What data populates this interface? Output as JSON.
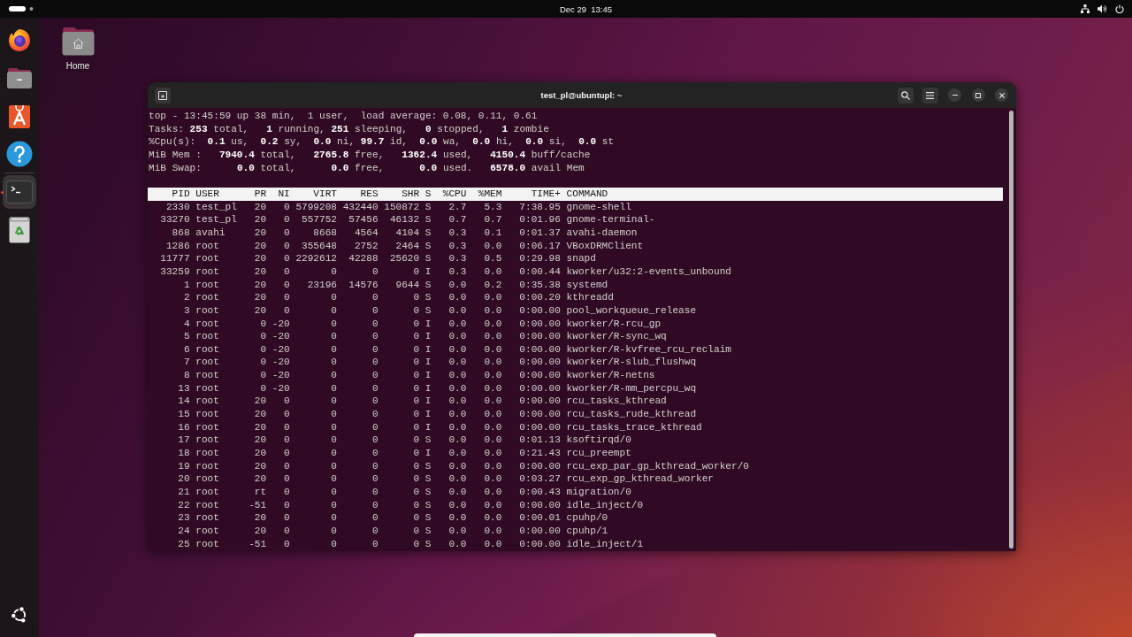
{
  "top_bar": {
    "clock": "Dec 29  13:45"
  },
  "dock": {
    "pinned": [
      {
        "kind": "browser",
        "running": false
      },
      {
        "kind": "files",
        "running": false
      },
      {
        "kind": "app-store",
        "running": false
      },
      {
        "kind": "help",
        "running": false
      }
    ],
    "other": [
      {
        "kind": "terminal",
        "running": true
      },
      {
        "kind": "trash",
        "running": false
      }
    ]
  },
  "desktop": {
    "icons": [
      {
        "label": "Home"
      }
    ]
  },
  "window": {
    "title": "test_pl@ubuntupl: ~",
    "summary": [
      "top - 13:45:59 up 38 min,  1 user,  load average: 0.08, 0.11, 0.61",
      "Tasks: **253** total,   **1** running, **251** sleeping,   **0** stopped,   **1** zombie",
      "%Cpu(s):  **0.1** us,  **0.2** sy,  **0.0** ni, **99.7** id,  **0.0** wa,  **0.0** hi,  **0.0** si,  **0.0** st",
      "MiB Mem :   **7940.4** total,   **2765.8** free,   **1362.4** used,   **4150.4** buff/cache",
      "MiB Swap:      **0.0** total,      **0.0** free,      **0.0** used.   **6578.0** avail Mem"
    ],
    "table": {
      "columns": [
        "PID",
        "USER",
        "PR",
        "NI",
        "VIRT",
        "RES",
        "SHR",
        "S",
        "%CPU",
        "%MEM",
        "TIME+",
        "COMMAND"
      ],
      "rows": [
        [
          "2330",
          "test_pl",
          "20",
          "0",
          "5799208",
          "432440",
          "150872",
          "S",
          "2.7",
          "5.3",
          "7:38.95",
          "gnome-shell"
        ],
        [
          "33270",
          "test_pl",
          "20",
          "0",
          "557752",
          "57456",
          "46132",
          "S",
          "0.7",
          "0.7",
          "0:01.96",
          "gnome-terminal-"
        ],
        [
          "868",
          "avahi",
          "20",
          "0",
          "8668",
          "4564",
          "4104",
          "S",
          "0.3",
          "0.1",
          "0:01.37",
          "avahi-daemon"
        ],
        [
          "1286",
          "root",
          "20",
          "0",
          "355648",
          "2752",
          "2464",
          "S",
          "0.3",
          "0.0",
          "0:06.17",
          "VBoxDRMClient"
        ],
        [
          "11777",
          "root",
          "20",
          "0",
          "2292612",
          "42288",
          "25620",
          "S",
          "0.3",
          "0.5",
          "0:29.98",
          "snapd"
        ],
        [
          "33259",
          "root",
          "20",
          "0",
          "0",
          "0",
          "0",
          "I",
          "0.3",
          "0.0",
          "0:00.44",
          "kworker/u32:2-events_unbound"
        ],
        [
          "1",
          "root",
          "20",
          "0",
          "23196",
          "14576",
          "9644",
          "S",
          "0.0",
          "0.2",
          "0:35.38",
          "systemd"
        ],
        [
          "2",
          "root",
          "20",
          "0",
          "0",
          "0",
          "0",
          "S",
          "0.0",
          "0.0",
          "0:00.20",
          "kthreadd"
        ],
        [
          "3",
          "root",
          "20",
          "0",
          "0",
          "0",
          "0",
          "S",
          "0.0",
          "0.0",
          "0:00.00",
          "pool_workqueue_release"
        ],
        [
          "4",
          "root",
          "0",
          "-20",
          "0",
          "0",
          "0",
          "I",
          "0.0",
          "0.0",
          "0:00.00",
          "kworker/R-rcu_gp"
        ],
        [
          "5",
          "root",
          "0",
          "-20",
          "0",
          "0",
          "0",
          "I",
          "0.0",
          "0.0",
          "0:00.00",
          "kworker/R-sync_wq"
        ],
        [
          "6",
          "root",
          "0",
          "-20",
          "0",
          "0",
          "0",
          "I",
          "0.0",
          "0.0",
          "0:00.00",
          "kworker/R-kvfree_rcu_reclaim"
        ],
        [
          "7",
          "root",
          "0",
          "-20",
          "0",
          "0",
          "0",
          "I",
          "0.0",
          "0.0",
          "0:00.00",
          "kworker/R-slub_flushwq"
        ],
        [
          "8",
          "root",
          "0",
          "-20",
          "0",
          "0",
          "0",
          "I",
          "0.0",
          "0.0",
          "0:00.00",
          "kworker/R-netns"
        ],
        [
          "13",
          "root",
          "0",
          "-20",
          "0",
          "0",
          "0",
          "I",
          "0.0",
          "0.0",
          "0:00.00",
          "kworker/R-mm_percpu_wq"
        ],
        [
          "14",
          "root",
          "20",
          "0",
          "0",
          "0",
          "0",
          "I",
          "0.0",
          "0.0",
          "0:00.00",
          "rcu_tasks_kthread"
        ],
        [
          "15",
          "root",
          "20",
          "0",
          "0",
          "0",
          "0",
          "I",
          "0.0",
          "0.0",
          "0:00.00",
          "rcu_tasks_rude_kthread"
        ],
        [
          "16",
          "root",
          "20",
          "0",
          "0",
          "0",
          "0",
          "I",
          "0.0",
          "0.0",
          "0:00.00",
          "rcu_tasks_trace_kthread"
        ],
        [
          "17",
          "root",
          "20",
          "0",
          "0",
          "0",
          "0",
          "S",
          "0.0",
          "0.0",
          "0:01.13",
          "ksoftirqd/0"
        ],
        [
          "18",
          "root",
          "20",
          "0",
          "0",
          "0",
          "0",
          "I",
          "0.0",
          "0.0",
          "0:21.43",
          "rcu_preempt"
        ],
        [
          "19",
          "root",
          "20",
          "0",
          "0",
          "0",
          "0",
          "S",
          "0.0",
          "0.0",
          "0:00.00",
          "rcu_exp_par_gp_kthread_worker/0"
        ],
        [
          "20",
          "root",
          "20",
          "0",
          "0",
          "0",
          "0",
          "S",
          "0.0",
          "0.0",
          "0:03.27",
          "rcu_exp_gp_kthread_worker"
        ],
        [
          "21",
          "root",
          "rt",
          "0",
          "0",
          "0",
          "0",
          "S",
          "0.0",
          "0.0",
          "0:00.43",
          "migration/0"
        ],
        [
          "22",
          "root",
          "-51",
          "0",
          "0",
          "0",
          "0",
          "S",
          "0.0",
          "0.0",
          "0:00.00",
          "idle_inject/0"
        ],
        [
          "23",
          "root",
          "20",
          "0",
          "0",
          "0",
          "0",
          "S",
          "0.0",
          "0.0",
          "0:00.01",
          "cpuhp/0"
        ],
        [
          "24",
          "root",
          "20",
          "0",
          "0",
          "0",
          "0",
          "S",
          "0.0",
          "0.0",
          "0:00.00",
          "cpuhp/1"
        ],
        [
          "25",
          "root",
          "-51",
          "0",
          "0",
          "0",
          "0",
          "S",
          "0.0",
          "0.0",
          "0:00.00",
          "idle_inject/1"
        ]
      ]
    }
  }
}
